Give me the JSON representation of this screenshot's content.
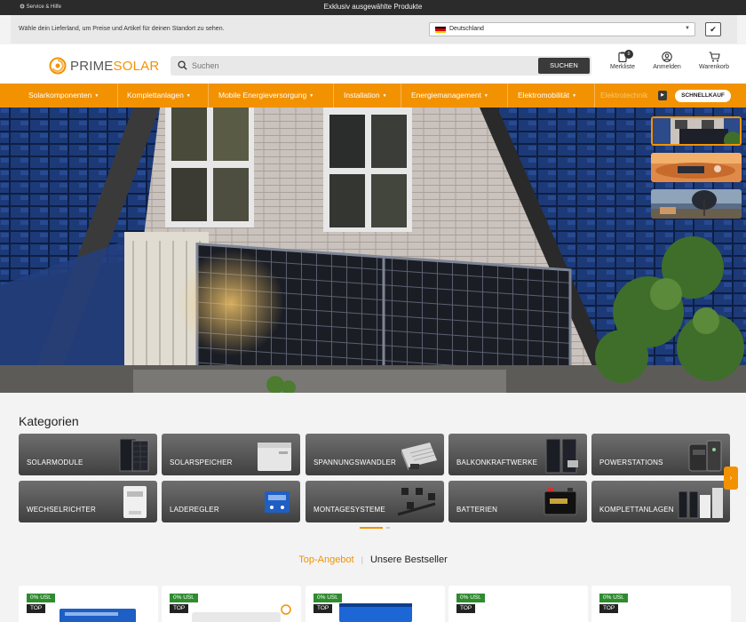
{
  "topbar": {
    "service": "Service & Hilfe",
    "promo": "Exklusiv ausgewählte Produkte"
  },
  "locale": {
    "message": "Wähle dein Lieferland, um Preise und Artikel für deinen Standort zu sehen.",
    "selected": "Deutschland",
    "confirm": "✔"
  },
  "header": {
    "logo_prime": "PRIME",
    "logo_solar": "SOLAR",
    "search_placeholder": "Suchen",
    "search_button": "SUCHEN",
    "wishlist_label": "Merkliste",
    "wishlist_count": "0",
    "login_label": "Anmelden",
    "cart_label": "Warenkorb"
  },
  "nav": {
    "items": [
      "Solarkomponenten",
      "Komplettanlagen",
      "Mobile Energieversorgung",
      "Installation",
      "Energiemanagement",
      "Elektromobilität"
    ],
    "faded": "Elektrotechnik",
    "more": "▶",
    "quick": "SCHNELLKAUF"
  },
  "categories": {
    "title": "Kategorien",
    "items": [
      "SOLARMODULE",
      "SOLARSPEICHER",
      "SPANNUNGSWANDLER",
      "BALKONKRAFTWERKE",
      "POWERSTATIONS",
      "WECHSELRICHTER",
      "LADEREGLER",
      "MONTAGESYSTEME",
      "BATTERIEN",
      "KOMPLETTANLAGEN"
    ],
    "next": "›"
  },
  "tabs": {
    "active": "Top-Angebot",
    "other": "Unsere Bestseller"
  },
  "products": {
    "badge_tax": "0% USt.",
    "badge_top": "TOP"
  },
  "colors": {
    "accent": "#f29200",
    "dark": "#2b2b2b",
    "badge_green": "#2e8b2e"
  }
}
